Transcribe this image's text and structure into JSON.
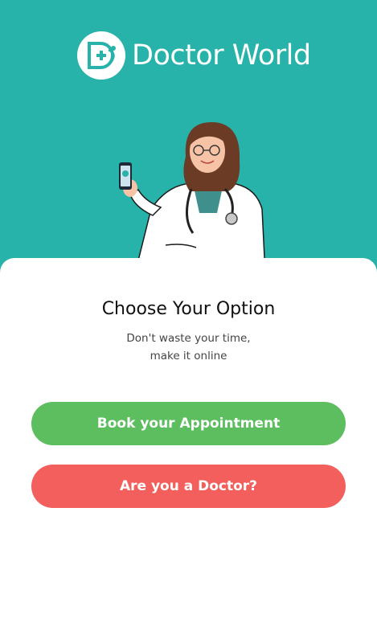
{
  "header": {
    "app_name": "Doctor World",
    "logo_icon": "doctor-world-logo-icon",
    "background_color": "#27b3aa"
  },
  "main": {
    "title": "Choose Your Option",
    "subtitle_line1": "Don't waste your time,",
    "subtitle_line2": "make it online"
  },
  "actions": {
    "book_label": "Book your Appointment",
    "book_color": "#5cbe5e",
    "doctor_label": "Are you a Doctor?",
    "doctor_color": "#f25f5c"
  }
}
